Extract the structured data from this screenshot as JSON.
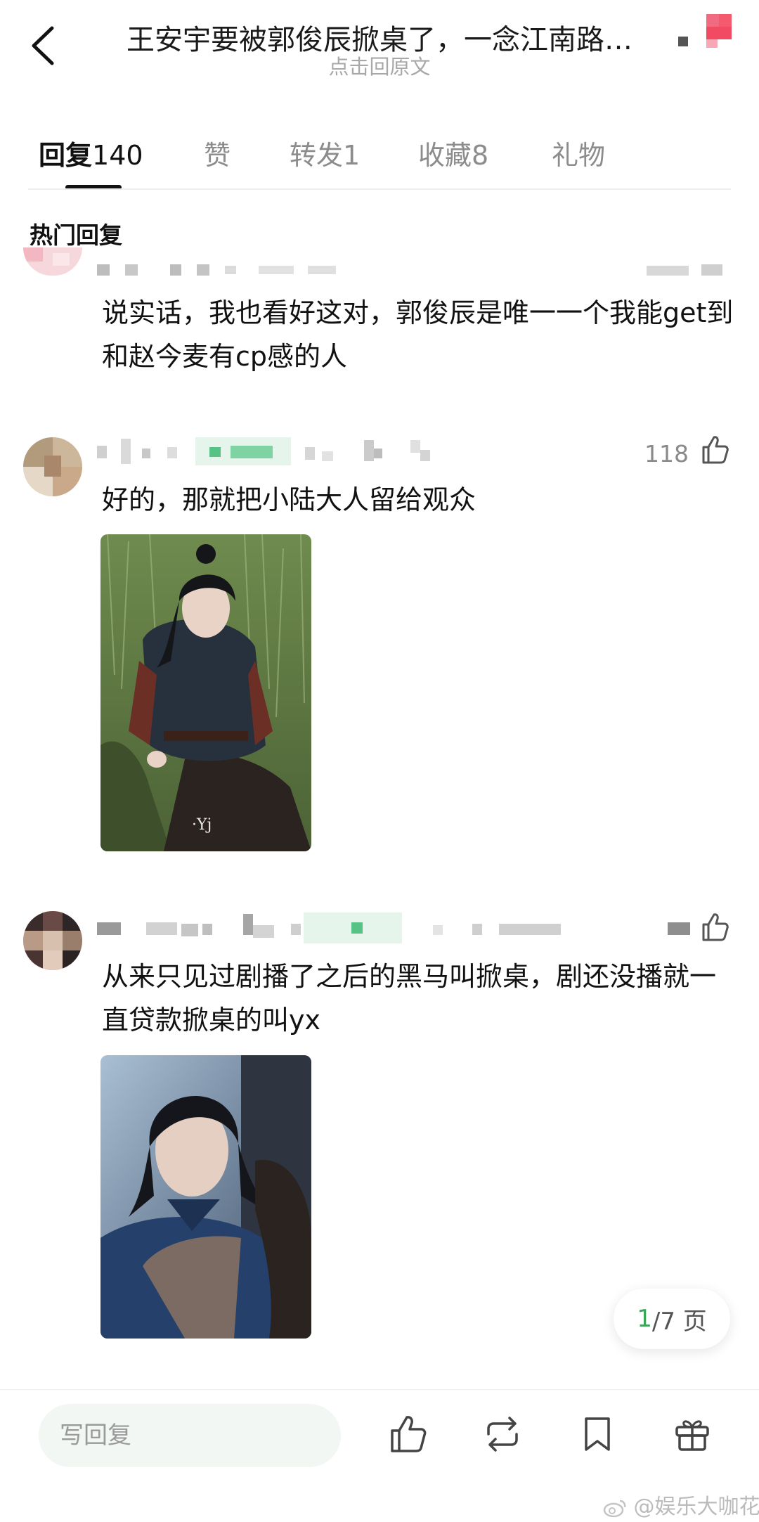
{
  "header": {
    "title": "王安宇要被郭俊辰掀桌了，一念江南路…",
    "subtitle": "点击回原文"
  },
  "tabs": [
    {
      "label": "回复",
      "count": "140"
    },
    {
      "label": "赞",
      "count": ""
    },
    {
      "label": "转发",
      "count": "1"
    },
    {
      "label": "收藏",
      "count": "8"
    },
    {
      "label": "礼物",
      "count": ""
    }
  ],
  "section_heading": "热门回复",
  "comments": [
    {
      "text": "说实话，我也看好这对，郭俊辰是唯一一个我能get到和赵今麦有cp感的人",
      "likes": ""
    },
    {
      "text": "好的，那就把小陆大人留给观众",
      "likes": "118"
    },
    {
      "text": "从来只见过剧播了之后的黑马叫掀桌，剧还没播就一直贷款掀桌的叫yx",
      "likes": ""
    }
  ],
  "pager": {
    "current": "1",
    "total": "/7 页"
  },
  "bottom_bar": {
    "reply_placeholder": "写回复",
    "icons": [
      "like-icon",
      "repost-icon",
      "bookmark-icon",
      "gift-icon"
    ]
  },
  "watermark": "@娱乐大咖花",
  "colors": {
    "accent_green": "#3aa657",
    "muted_text": "#8c8c8c"
  }
}
